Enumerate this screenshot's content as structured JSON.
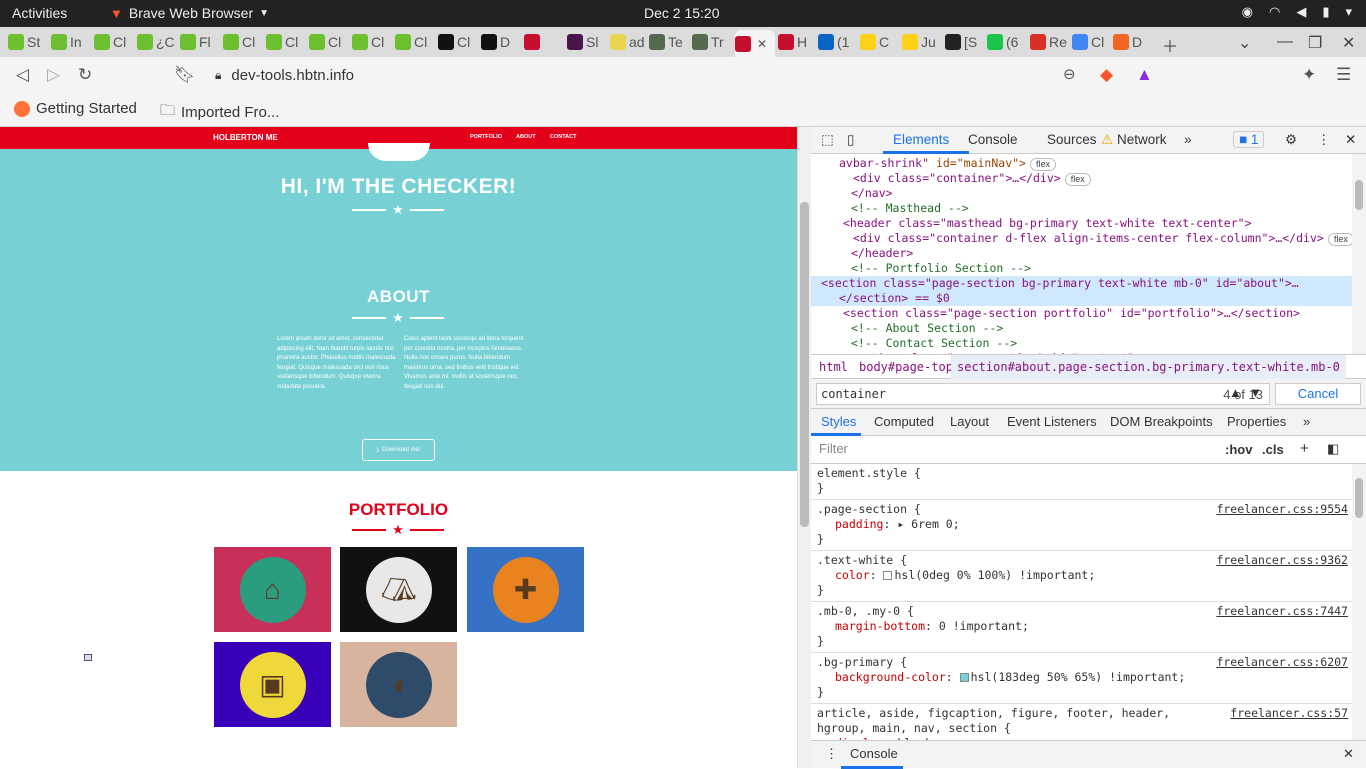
{
  "system": {
    "activities": "Activities",
    "app_name": "Brave Web Browser",
    "clock": "Dec 2  15:20"
  },
  "tabs": [
    {
      "label": "St",
      "color": "#6cbf2f"
    },
    {
      "label": "In",
      "color": "#6cbf2f"
    },
    {
      "label": "Cl",
      "color": "#6cbf2f"
    },
    {
      "label": "¿C",
      "color": "#6cbf2f"
    },
    {
      "label": "Fl",
      "color": "#6cbf2f"
    },
    {
      "label": "Cl",
      "color": "#6cbf2f"
    },
    {
      "label": "Cl",
      "color": "#6cbf2f"
    },
    {
      "label": "Cl",
      "color": "#6cbf2f"
    },
    {
      "label": "Cl",
      "color": "#6cbf2f"
    },
    {
      "label": "Cl",
      "color": "#6cbf2f"
    },
    {
      "label": "Cl",
      "color": "#111111"
    },
    {
      "label": "D",
      "color": "#111111"
    },
    {
      "label": "",
      "color": "#c4102e"
    },
    {
      "label": "Sl",
      "color": "#4a154b"
    },
    {
      "label": "ad",
      "color": "#e8d44d"
    },
    {
      "label": "Te",
      "color": "#556b4f"
    },
    {
      "label": "Tr",
      "color": "#556b4f"
    },
    {
      "label": "",
      "color": "#c4102e"
    },
    {
      "label": "H",
      "color": "#c4102e"
    },
    {
      "label": "(1",
      "color": "#0a66c2"
    },
    {
      "label": "C",
      "color": "#fcd116"
    },
    {
      "label": "Ju",
      "color": "#fcd116"
    },
    {
      "label": "[S",
      "color": "#222222"
    },
    {
      "label": "(6",
      "color": "#1dc44a"
    },
    {
      "label": "Re",
      "color": "#d93025"
    },
    {
      "label": "Cl",
      "color": "#4285f4"
    },
    {
      "label": "D",
      "color": "#f26522"
    }
  ],
  "active_tab_index": 17,
  "address": {
    "url": "dev-tools.hbtn.info"
  },
  "bookmarks": [
    {
      "label": "Getting Started"
    },
    {
      "label": "Imported Fro..."
    }
  ],
  "site": {
    "brand": "HOLBERTON ME",
    "nav": [
      "PORTFOLIO",
      "ABOUT",
      "CONTACT"
    ],
    "hero_title": "HI, I'M THE CHECKER!",
    "about_title": "ABOUT",
    "about_left": "Lorem ipsum dolor sit amet, consectetur adipiscing elit. Nam blandit turpis iaculis nisl pharetra auctor. Phasellus mattis malesuada feugiat. Quisque malesuada orci non risus scelerisque bibendum. Quisque viverra vulputate posuere.",
    "about_right": "Class aptent taciti sociosqu ad litora torquent per conubia nostra, per inceptos himenaeos. Nulla non ornare purus. Nulla bibendum maximus urna, sed finibus velit tristique vel. Vivamus ante mi, mollis at scelerisque nec, feugiat non dui.",
    "download_label": "Download me!",
    "portfolio_title": "PORTFOLIO",
    "portfolio_tiles": [
      {
        "icon": "cabin-icon",
        "bg": "#c8305a",
        "circle": "#2a9d7f"
      },
      {
        "icon": "circus-tent-icon",
        "bg": "#111111",
        "circle": "#e8e8e8"
      },
      {
        "icon": "game-controller-icon",
        "bg": "#3572c6",
        "circle": "#e8831f"
      },
      {
        "icon": "safe-icon",
        "bg": "#3800b8",
        "circle": "#f0d83a"
      },
      {
        "icon": "submarine-icon",
        "bg": "#d8b39e",
        "circle": "#2f4b6a"
      }
    ],
    "colors": {
      "primary": "#e2001a",
      "masthead": "#76d0d4"
    }
  },
  "devtools": {
    "tabs": [
      "Elements",
      "Console",
      "Sources",
      "Network"
    ],
    "issues_count": "1",
    "dom_lines": [
      {
        "type": "open",
        "tag": "avbar-shrink\"",
        "attrs": "id=\"mainNav\">",
        "flex": true
      },
      {
        "type": "node",
        "text": "<div class=\"container\">…</div>",
        "flex": true
      },
      {
        "type": "close",
        "text": "</nav>"
      },
      {
        "type": "comment",
        "text": "<!-- Masthead -->"
      },
      {
        "type": "node",
        "text": "<header class=\"masthead bg-primary text-white text-center\">"
      },
      {
        "type": "node",
        "text": "<div class=\"container d-flex align-items-center flex-column\">…</div>",
        "flex": true
      },
      {
        "type": "close",
        "text": "</header>"
      },
      {
        "type": "comment",
        "text": "<!-- Portfolio Section -->"
      },
      {
        "type": "selected",
        "text": "<section class=\"page-section bg-primary text-white mb-0\" id=\"about\">…"
      },
      {
        "type": "selected2",
        "text": "</section> == $0"
      },
      {
        "type": "node",
        "text": "<section class=\"page-section portfolio\" id=\"portfolio\">…</section>"
      },
      {
        "type": "comment",
        "text": "<!-- About Section -->"
      },
      {
        "type": "comment",
        "text": "<!-- Contact Section -->"
      },
      {
        "type": "node",
        "text": "<section class=\"page-section\" id=\"contact\">"
      }
    ],
    "breadcrumbs": [
      "html",
      "body#page-top",
      "section#about.page-section.bg-primary.text-white.mb-0"
    ],
    "search": {
      "value": "container",
      "count": "4 of 13",
      "cancel": "Cancel"
    },
    "style_tabs": [
      "Styles",
      "Computed",
      "Layout",
      "Event Listeners",
      "DOM Breakpoints",
      "Properties"
    ],
    "filter_placeholder": "Filter",
    "hov": ":hov",
    "cls": ".cls",
    "rules": [
      {
        "selector": "element.style {",
        "source": "",
        "props": []
      },
      {
        "selector": ".page-section {",
        "source": "freelancer.css:9554",
        "props": [
          {
            "name": "padding",
            "value": "▸ 6rem 0;"
          }
        ]
      },
      {
        "selector": ".text-white {",
        "source": "freelancer.css:9362",
        "props": [
          {
            "name": "color",
            "value": "hsl(0deg 0% 100%) !important;",
            "swatch": "#ffffff"
          }
        ]
      },
      {
        "selector": ".mb-0, .my-0 {",
        "source": "freelancer.css:7447",
        "props": [
          {
            "name": "margin-bottom",
            "value": "0 !important;"
          }
        ]
      },
      {
        "selector": ".bg-primary {",
        "source": "freelancer.css:6207",
        "props": [
          {
            "name": "background-color",
            "value": "hsl(183deg 50% 65%) !important;",
            "swatch": "#76d0d4"
          }
        ]
      },
      {
        "selector": "article, aside, figcaption, figure, footer, header, hgroup, main, nav, section {",
        "source": "freelancer.css:57",
        "props": [
          {
            "name": "display",
            "value": "block;"
          }
        ]
      }
    ],
    "drawer_label": "Console"
  }
}
